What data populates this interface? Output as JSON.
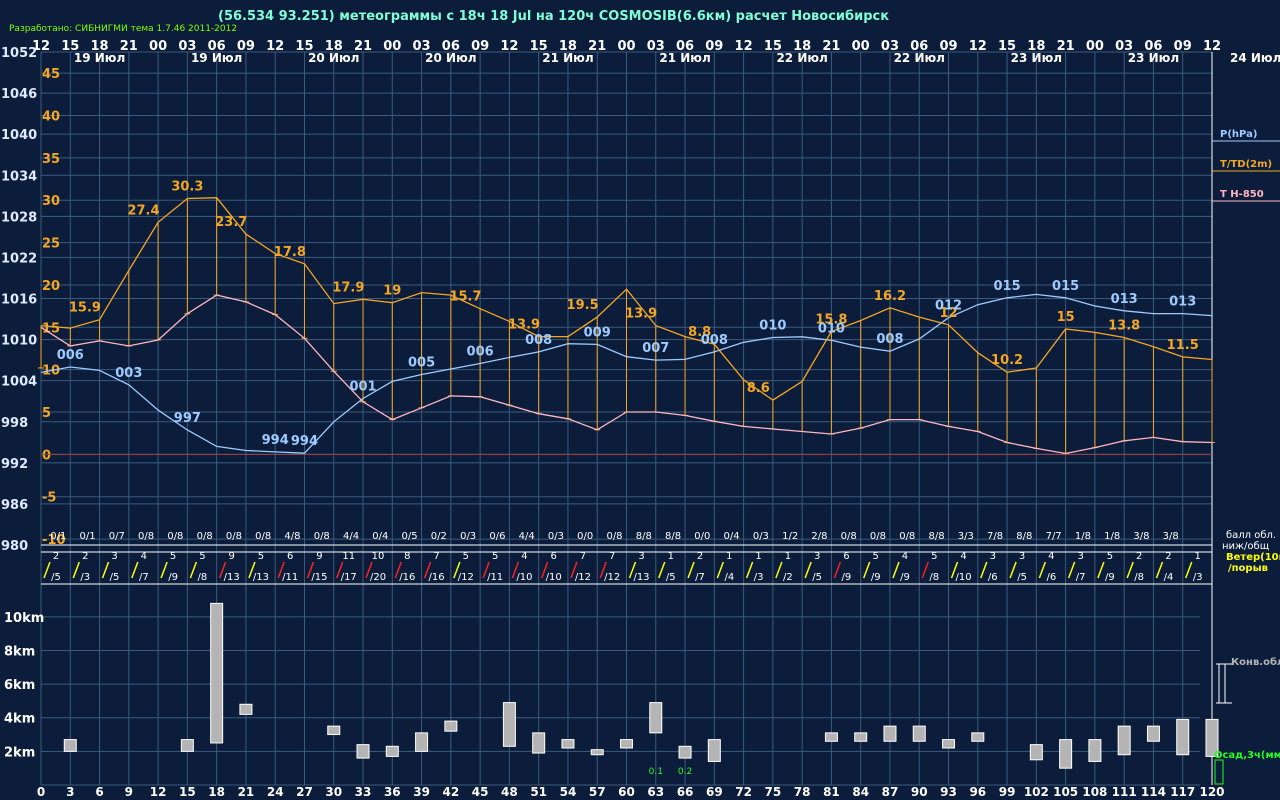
{
  "header": {
    "credit": "Разработано: СИБНИГМИ тема 1.7.46 2011-2012",
    "title": "(56.534 93.251) метеограммы с  18ч 18 Jul на 120ч COSMOSIB(6.6км) расчет Новосибирск"
  },
  "legend": {
    "pressure": "P(hPa)",
    "temp": "T/TD(2m)",
    "t850": "T H-850",
    "cloud_label_1": "балл обл.",
    "cloud_label_2": "ниж/общ",
    "wind_label_1": "Ветер(10м",
    "wind_label_2": "/порыв",
    "conv": "Конв.обл.",
    "precip": "Осад,3ч(мм)",
    "last_date": "24 Июл"
  },
  "colors": {
    "background": "#0b1d3a",
    "grid": "#3b5b7e",
    "pressure": "#9ecbff",
    "temperature": "#f5a623",
    "t850": "#ffb6c1",
    "zero_line": "#a04040",
    "wind_normal": "#ffff00",
    "wind_strong": "#ff2020",
    "cloud_bar": "#b4b4b4",
    "precip": "#22ff22"
  },
  "chart_data": {
    "type": "line",
    "forecast_hours": [
      0,
      3,
      6,
      9,
      12,
      15,
      18,
      21,
      24,
      27,
      30,
      33,
      36,
      39,
      42,
      45,
      48,
      51,
      54,
      57,
      60,
      63,
      66,
      69,
      72,
      75,
      78,
      81,
      84,
      87,
      90,
      93,
      96,
      99,
      102,
      105,
      108,
      111,
      114,
      117,
      120
    ],
    "hour_labels": [
      "12",
      "15",
      "18",
      "21",
      "00",
      "03",
      "06",
      "09",
      "12",
      "15",
      "18",
      "21",
      "00",
      "03",
      "06",
      "09",
      "12",
      "15",
      "18",
      "21",
      "00",
      "03",
      "06",
      "09",
      "12",
      "15",
      "18",
      "21",
      "00",
      "03",
      "06",
      "09",
      "12",
      "15",
      "18",
      "21",
      "00",
      "03",
      "06",
      "09",
      "12"
    ],
    "date_labels": [
      "19 Июл",
      "19 Июл",
      "20 Июл",
      "20 Июл",
      "21 Июл",
      "21 Июл",
      "22 Июл",
      "22 Июл",
      "23 Июл",
      "23 Июл"
    ],
    "pressure_axis": {
      "label": "P(hPa)",
      "ticks": [
        1052,
        1046,
        1040,
        1034,
        1028,
        1022,
        1016,
        1010,
        1004,
        998,
        992,
        986,
        980
      ],
      "range": [
        980,
        1052
      ]
    },
    "temperature_axis": {
      "label": "T/TD(2m)",
      "ticks": [
        45,
        40,
        35,
        30,
        25,
        20,
        15,
        10,
        5,
        0,
        -5,
        -10
      ],
      "range": [
        -10.7,
        47.5
      ]
    },
    "series": [
      {
        "name": "P(hPa)",
        "values": [
          1005.2,
          1006.0,
          1005.5,
          1003.4,
          999.7,
          996.8,
          994.4,
          993.8,
          993.6,
          993.4,
          998.0,
          1001.4,
          1003.9,
          1004.9,
          1005.7,
          1006.5,
          1007.4,
          1008.2,
          1009.4,
          1009.3,
          1007.5,
          1007.0,
          1007.1,
          1008.2,
          1009.6,
          1010.3,
          1010.4,
          1009.9,
          1008.9,
          1008.3,
          1010.1,
          1013.2,
          1015.1,
          1016.1,
          1016.6,
          1016.1,
          1014.9,
          1014.2,
          1013.8,
          1013.8,
          1013.5
        ]
      },
      {
        "name": "T/TD(2m)",
        "values": [
          15.2,
          14.9,
          15.9,
          21.7,
          27.4,
          30.2,
          30.3,
          26.0,
          23.7,
          22.5,
          17.8,
          18.3,
          17.9,
          19.1,
          18.8,
          17.2,
          15.7,
          13.9,
          13.9,
          16.2,
          19.5,
          15.2,
          13.9,
          13.0,
          8.8,
          6.4,
          8.6,
          14.5,
          15.8,
          17.3,
          16.2,
          15.3,
          12.0,
          9.7,
          10.2,
          14.8,
          14.4,
          13.8,
          12.7,
          11.5,
          11.2
        ]
      },
      {
        "name": "Td(2m)",
        "values": [
          10.2,
          12.8,
          13.4,
          12.8,
          13.5,
          16.6,
          18.8,
          18.0,
          16.5,
          13.7,
          9.8,
          6.2,
          4.1,
          5.5,
          6.9,
          6.8,
          5.8,
          4.8,
          4.2,
          2.9,
          5.0,
          5.0,
          4.6,
          3.9,
          3.3,
          3.0,
          2.7,
          2.4,
          3.1,
          4.1,
          4.1,
          3.3,
          2.7,
          1.4,
          0.7,
          0.1,
          0.8,
          1.6,
          2.0,
          1.5,
          1.4
        ]
      },
      {
        "name": "T H-850",
        "values": [
          15.0,
          12.8,
          13.4,
          12.8,
          13.5,
          16.6,
          18.8,
          18.0,
          16.5,
          13.7,
          9.8,
          6.2,
          4.1,
          5.5,
          6.9,
          6.8,
          5.8,
          4.8,
          4.2,
          2.9,
          5.0,
          5.0,
          4.6,
          3.9,
          3.3,
          3.0,
          2.7,
          2.4,
          3.1,
          4.1,
          4.1,
          3.3,
          2.7,
          1.4,
          0.7,
          0.1,
          0.8,
          1.6,
          2.0,
          1.5,
          1.4
        ]
      }
    ],
    "temp_labels": [
      {
        "hour": 9,
        "text": "15.9"
      },
      {
        "hour": 21,
        "text": "27.4"
      },
      {
        "hour": 30,
        "text": "30.3"
      },
      {
        "hour": 39,
        "text": "23.7"
      },
      {
        "hour": 51,
        "text": "17.8"
      },
      {
        "hour": 63,
        "text": "17.9"
      },
      {
        "hour": 72,
        "text": "19"
      },
      {
        "hour": 87,
        "text": "15.7"
      },
      {
        "hour": 99,
        "text": "13.9"
      },
      {
        "hour": 111,
        "text": "19.5"
      },
      {
        "hour": 123,
        "text": "13.9"
      },
      {
        "hour": 135,
        "text": "8.8"
      },
      {
        "hour": 147,
        "text": "8.6"
      },
      {
        "hour": 162,
        "text": "15.8"
      },
      {
        "hour": 174,
        "text": "16.2"
      },
      {
        "hour": 186,
        "text": "12"
      },
      {
        "hour": 198,
        "text": "10.2"
      },
      {
        "hour": 210,
        "text": "15"
      },
      {
        "hour": 222,
        "text": "13.8"
      },
      {
        "hour": 234,
        "text": "11.5"
      }
    ],
    "pressure_labels": [
      "006",
      "003",
      "997",
      "994",
      "994",
      "001",
      "005",
      "006",
      "008",
      "009",
      "007",
      "008",
      "010",
      "010",
      "008",
      "012",
      "015",
      "015",
      "013",
      "013"
    ],
    "cloud_cover": [
      "0/1",
      "0/1",
      "0/7",
      "0/8",
      "0/8",
      "0/8",
      "0/8",
      "0/8",
      "4/8",
      "0/8",
      "4/4",
      "0/4",
      "0/5",
      "0/2",
      "0/3",
      "0/6",
      "4/4",
      "0/3",
      "0/0",
      "0/8",
      "8/8",
      "8/8",
      "0/0",
      "0/4",
      "0/3",
      "1/2",
      "2/8",
      "0/8",
      "0/8",
      "0/8",
      "8/8",
      "3/3",
      "7/8",
      "8/8",
      "7/7",
      "1/8",
      "1/8",
      "3/8",
      "3/8"
    ],
    "wind": [
      {
        "speed": "2",
        "gust": "/5",
        "strong": false
      },
      {
        "speed": "2",
        "gust": "/3",
        "strong": false
      },
      {
        "speed": "3",
        "gust": "/5",
        "strong": false
      },
      {
        "speed": "4",
        "gust": "/7",
        "strong": false
      },
      {
        "speed": "5",
        "gust": "/9",
        "strong": false
      },
      {
        "speed": "5",
        "gust": "/8",
        "strong": false
      },
      {
        "speed": "9",
        "gust": "/13",
        "strong": true
      },
      {
        "speed": "5",
        "gust": "/13",
        "strong": false
      },
      {
        "speed": "6",
        "gust": "/11",
        "strong": true
      },
      {
        "speed": "9",
        "gust": "/15",
        "strong": true
      },
      {
        "speed": "11",
        "gust": "/17",
        "strong": true
      },
      {
        "speed": "10",
        "gust": "/20",
        "strong": true
      },
      {
        "speed": "8",
        "gust": "/16",
        "strong": true
      },
      {
        "speed": "7",
        "gust": "/16",
        "strong": true
      },
      {
        "speed": "5",
        "gust": "/12",
        "strong": false
      },
      {
        "speed": "5",
        "gust": "/11",
        "strong": true
      },
      {
        "speed": "4",
        "gust": "/10",
        "strong": true
      },
      {
        "speed": "6",
        "gust": "/10",
        "strong": true
      },
      {
        "speed": "7",
        "gust": "/12",
        "strong": true
      },
      {
        "speed": "7",
        "gust": "/12",
        "strong": true
      },
      {
        "speed": "3",
        "gust": "/13",
        "strong": false
      },
      {
        "speed": "1",
        "gust": "/5",
        "strong": false
      },
      {
        "speed": "2",
        "gust": "/7",
        "strong": false
      },
      {
        "speed": "1",
        "gust": "/4",
        "strong": false
      },
      {
        "speed": "1",
        "gust": "/3",
        "strong": false
      },
      {
        "speed": "1",
        "gust": "/2",
        "strong": false
      },
      {
        "speed": "3",
        "gust": "/5",
        "strong": false
      },
      {
        "speed": "6",
        "gust": "/9",
        "strong": true
      },
      {
        "speed": "5",
        "gust": "/9",
        "strong": false
      },
      {
        "speed": "4",
        "gust": "/9",
        "strong": false
      },
      {
        "speed": "5",
        "gust": "/8",
        "strong": true
      },
      {
        "speed": "4",
        "gust": "/10",
        "strong": false
      },
      {
        "speed": "3",
        "gust": "/6",
        "strong": false
      },
      {
        "speed": "3",
        "gust": "/5",
        "strong": false
      },
      {
        "speed": "4",
        "gust": "/6",
        "strong": false
      },
      {
        "speed": "3",
        "gust": "/7",
        "strong": false
      },
      {
        "speed": "5",
        "gust": "/9",
        "strong": false
      },
      {
        "speed": "2",
        "gust": "/8",
        "strong": false
      },
      {
        "speed": "2",
        "gust": "/4",
        "strong": false
      },
      {
        "speed": "1",
        "gust": "/3",
        "strong": false
      }
    ],
    "height_axis": {
      "ticks": [
        "10km",
        "8km",
        "6km",
        "4km",
        "2km"
      ],
      "range_km": [
        0,
        11
      ]
    },
    "bottom_hours": [
      "0",
      "3",
      "6",
      "9",
      "12",
      "15",
      "18",
      "21",
      "24",
      "27",
      "30",
      "33",
      "36",
      "39",
      "42",
      "45",
      "48",
      "51",
      "54",
      "57",
      "60",
      "63",
      "66",
      "69",
      "72",
      "75",
      "78",
      "81",
      "84",
      "87",
      "90",
      "93",
      "96",
      "99",
      "102",
      "105",
      "108",
      "111",
      "114",
      "117",
      "120"
    ],
    "convective_clouds": [
      {
        "hour": 3,
        "base": 2.0,
        "top": 2.7
      },
      {
        "hour": 15,
        "base": 2.0,
        "top": 2.7
      },
      {
        "hour": 18,
        "base": 2.5,
        "top": 10.8
      },
      {
        "hour": 21,
        "base": 4.2,
        "top": 4.8
      },
      {
        "hour": 30,
        "base": 3.0,
        "top": 3.5
      },
      {
        "hour": 33,
        "base": 1.6,
        "top": 2.4
      },
      {
        "hour": 36,
        "base": 1.7,
        "top": 2.3
      },
      {
        "hour": 39,
        "base": 2.0,
        "top": 3.1
      },
      {
        "hour": 42,
        "base": 3.2,
        "top": 3.8
      },
      {
        "hour": 48,
        "base": 2.3,
        "top": 4.9
      },
      {
        "hour": 51,
        "base": 1.9,
        "top": 3.1
      },
      {
        "hour": 54,
        "base": 2.2,
        "top": 2.7
      },
      {
        "hour": 57,
        "base": 1.8,
        "top": 2.1
      },
      {
        "hour": 60,
        "base": 2.2,
        "top": 2.7
      },
      {
        "hour": 63,
        "base": 3.1,
        "top": 4.9
      },
      {
        "hour": 66,
        "base": 1.6,
        "top": 2.3
      },
      {
        "hour": 69,
        "base": 1.4,
        "top": 2.7
      },
      {
        "hour": 81,
        "base": 2.6,
        "top": 3.1
      },
      {
        "hour": 84,
        "base": 2.6,
        "top": 3.1
      },
      {
        "hour": 87,
        "base": 2.6,
        "top": 3.5
      },
      {
        "hour": 90,
        "base": 2.6,
        "top": 3.5
      },
      {
        "hour": 93,
        "base": 2.2,
        "top": 2.7
      },
      {
        "hour": 96,
        "base": 2.6,
        "top": 3.1
      },
      {
        "hour": 102,
        "base": 1.5,
        "top": 2.4
      },
      {
        "hour": 105,
        "base": 1.0,
        "top": 2.7
      },
      {
        "hour": 108,
        "base": 1.4,
        "top": 2.7
      },
      {
        "hour": 111,
        "base": 1.8,
        "top": 3.5
      },
      {
        "hour": 114,
        "base": 2.6,
        "top": 3.5
      },
      {
        "hour": 117,
        "base": 1.8,
        "top": 3.9
      },
      {
        "hour": 120,
        "base": 1.7,
        "top": 3.9
      }
    ],
    "precipitation": [
      {
        "hour": 63,
        "value": "0.1"
      },
      {
        "hour": 66,
        "value": "0.2"
      }
    ]
  }
}
